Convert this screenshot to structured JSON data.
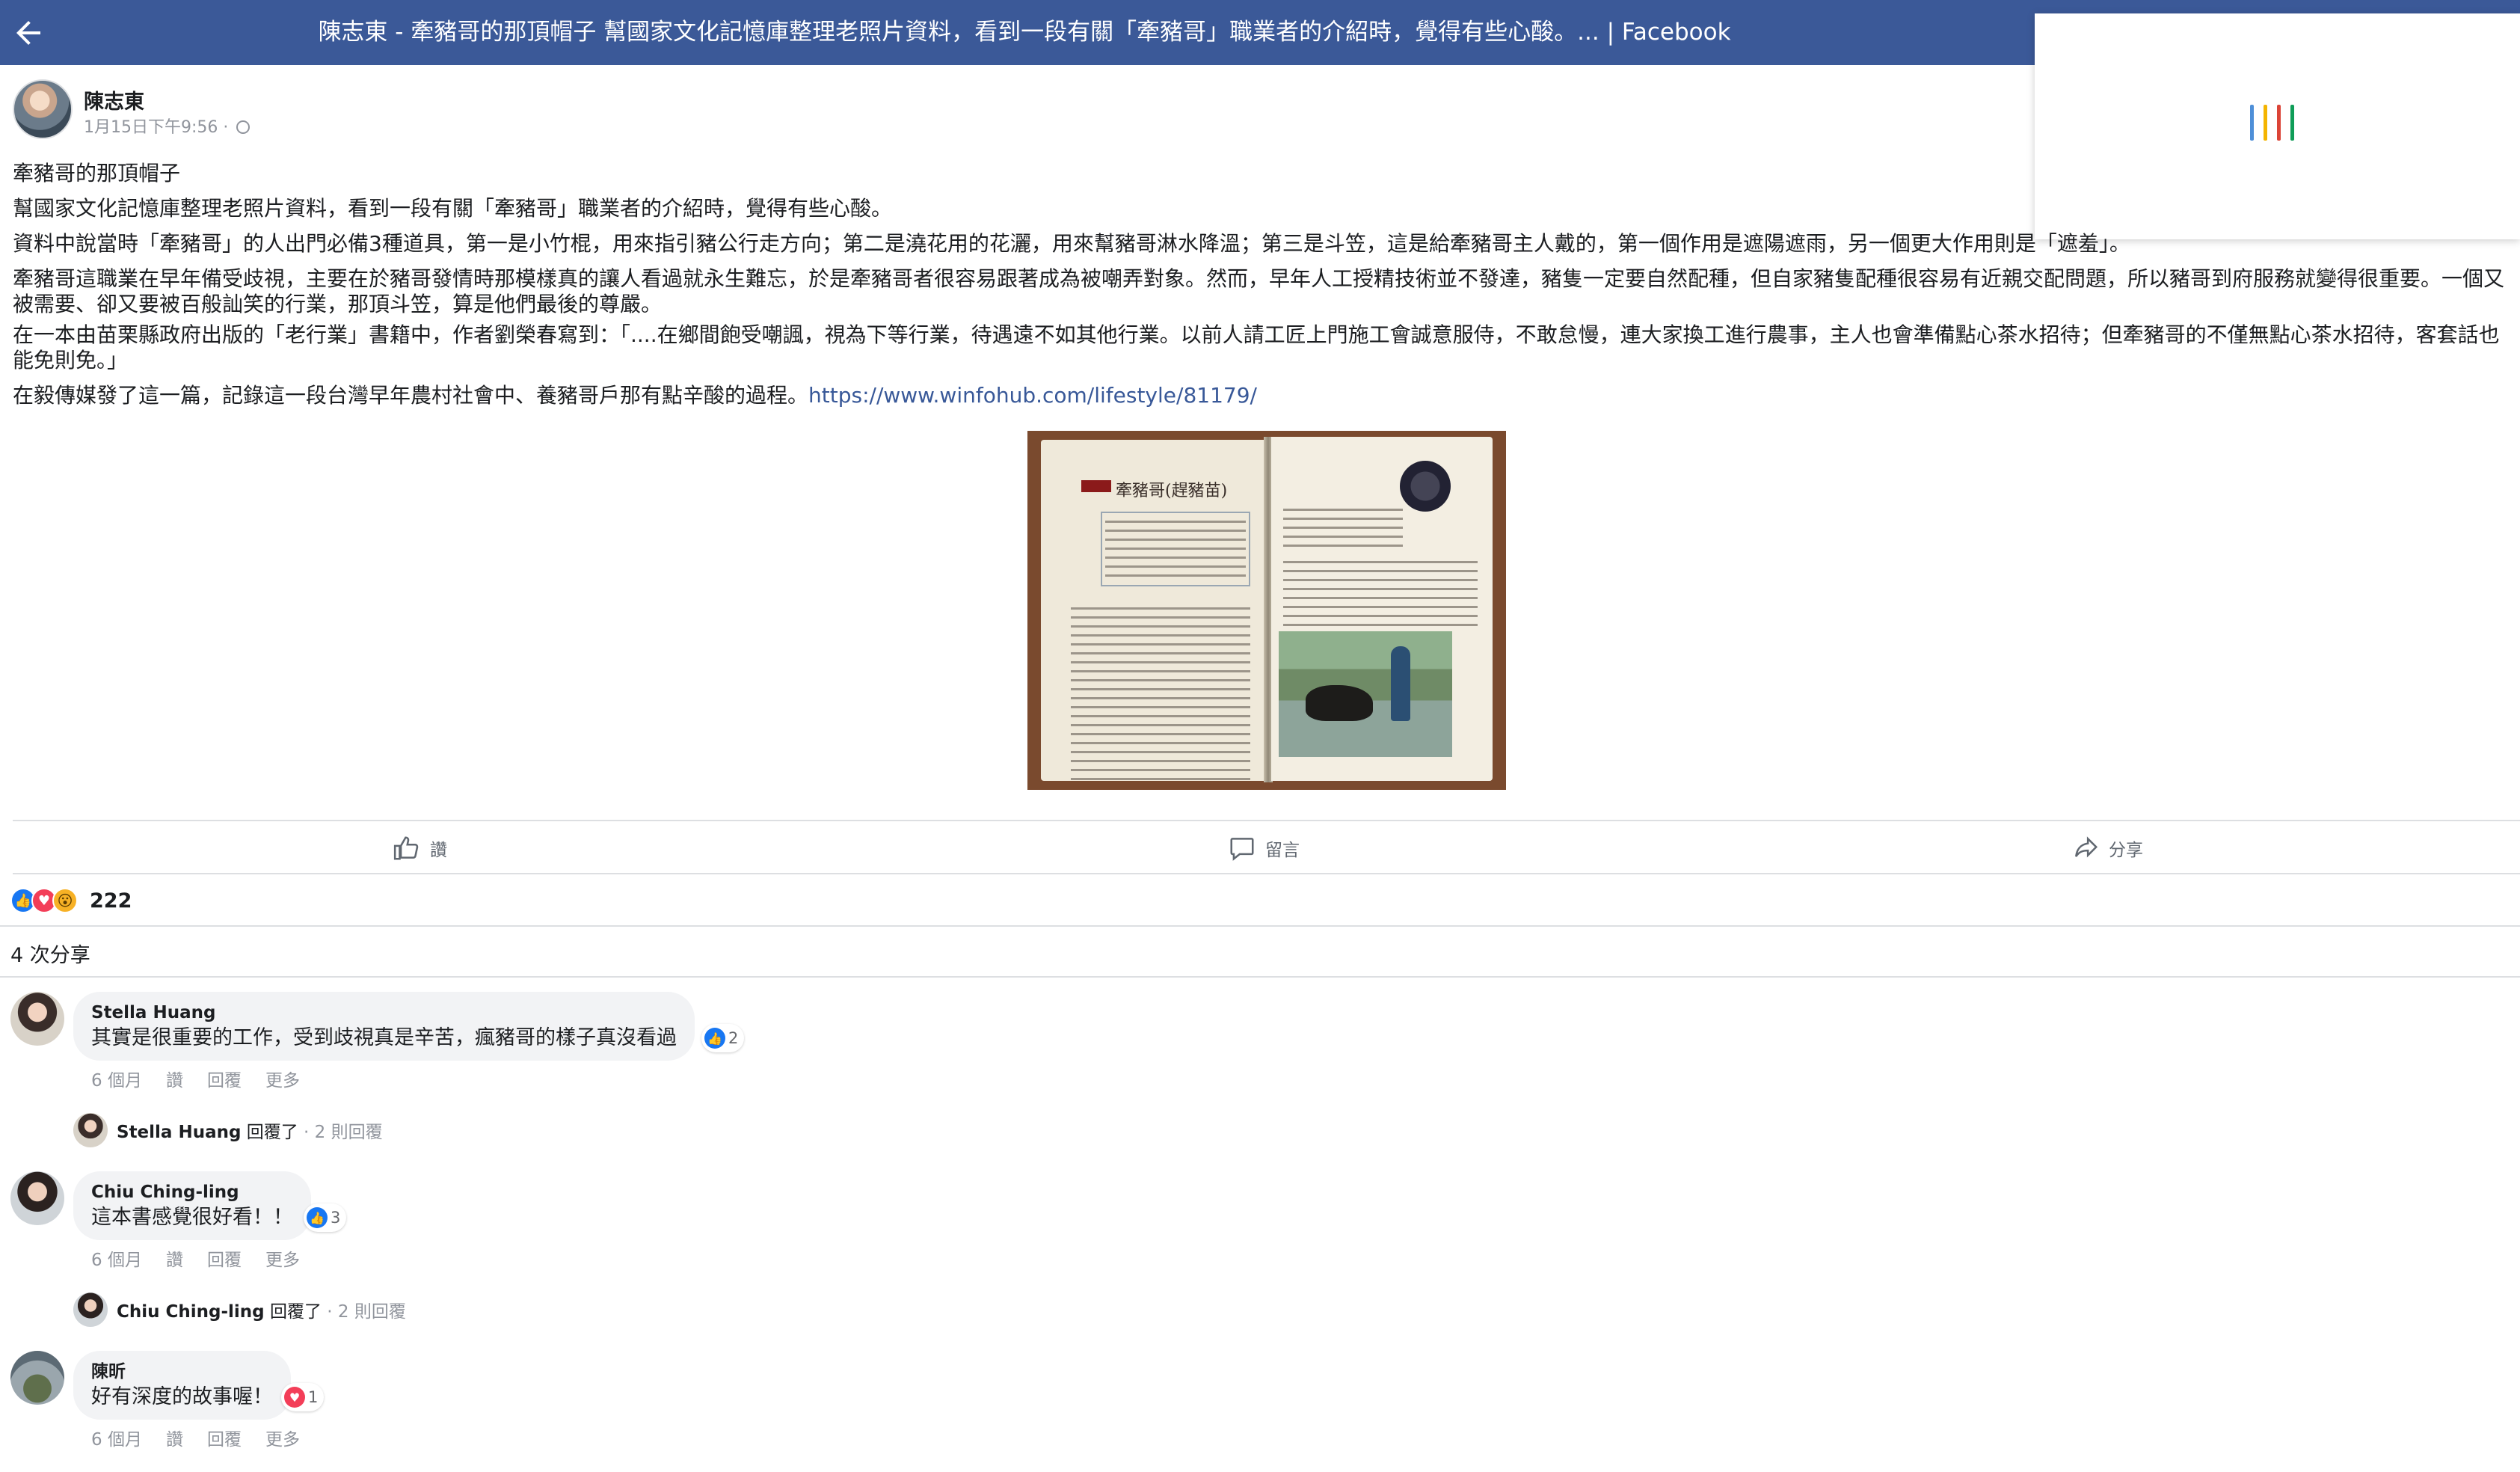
{
  "header": {
    "title": "陳志東 - 牽豬哥的那頂帽子 幫國家文化記憶庫整理老照片資料，看到一段有關「牽豬哥」職業者的介紹時，覺得有些心酸。... | Facebook",
    "bg_color": "#3b5998",
    "back_icon": "arrow-left-icon"
  },
  "loading": {
    "colors": [
      "#4e8fd8",
      "#f4b400",
      "#db4437",
      "#0f9d58"
    ]
  },
  "post": {
    "author": "陳志東",
    "time": "1月15日下午9:56 · ",
    "privacy_icon": "globe-icon",
    "paragraphs": [
      "牽豬哥的那頂帽子",
      "幫國家文化記憶庫整理老照片資料，看到一段有關「牽豬哥」職業者的介紹時，覺得有些心酸。",
      "資料中說當時「牽豬哥」的人出門必備3種道具，第一是小竹棍，用來指引豬公行走方向；第二是澆花用的花灑，用來幫豬哥淋水降溫；第三是斗笠，這是給牽豬哥主人戴的，第一個作用是遮陽遮雨，另一個更大作用則是「遮羞」。",
      "牽豬哥這職業在早年備受歧視，主要在於豬哥發情時那模樣真的讓人看過就永生難忘，於是牽豬哥者很容易跟著成為被嘲弄對象。然而，早年人工授精技術並不發達，豬隻一定要自然配種，但自家豬隻配種很容易有近親交配問題，所以豬哥到府服務就變得很重要。一個又被需要、卻又要被百般訕笑的行業，那頂斗笠，算是他們最後的尊嚴。",
      "在一本由苗栗縣政府出版的「老行業」書籍中，作者劉榮春寫到：「....在鄉間飽受嘲諷，視為下等行業，待遇遠不如其他行業。以前人請工匠上門施工會誠意服侍，不敢怠慢，連大家換工進行農事，主人也會準備點心茶水招待；但牽豬哥的不僅無點心茶水招待，客套話也能免則免。」",
      "在毅傳媒發了這一篇，記錄這一段台灣早年農村社會中、養豬哥戶那有點辛酸的過程。"
    ],
    "link": "https://www.winfohub.com/lifestyle/81179/",
    "image": {
      "book_heading": "牽豬哥(趕豬苗)"
    }
  },
  "actions": {
    "like": "讚",
    "comment": "留言",
    "share": "分享"
  },
  "stats": {
    "reaction_count": "222",
    "shares": "4 次分享"
  },
  "comments": [
    {
      "name": "Stella Huang",
      "text": "其實是很重要的工作，受到歧視真是辛苦，瘋豬哥的樣子真沒看過",
      "reaction_count": "2",
      "time": "6 個月",
      "like": "讚",
      "reply": "回覆",
      "more": "更多",
      "reply_summary": {
        "name": "Stella Huang",
        "verb": " 回覆了",
        "count": " · 2 則回覆"
      }
    },
    {
      "name": "Chiu Ching-ling",
      "text": "這本書感覺很好看！！",
      "reaction_count": "3",
      "time": "6 個月",
      "like": "讚",
      "reply": "回覆",
      "more": "更多",
      "reply_summary": {
        "name": "Chiu Ching-ling",
        "verb": " 回覆了",
        "count": " · 2 則回覆"
      }
    },
    {
      "name": "陳昕",
      "text": "好有深度的故事喔！",
      "reaction_count": "1",
      "time": "6 個月",
      "like": "讚",
      "reply": "回覆",
      "more": "更多"
    }
  ]
}
